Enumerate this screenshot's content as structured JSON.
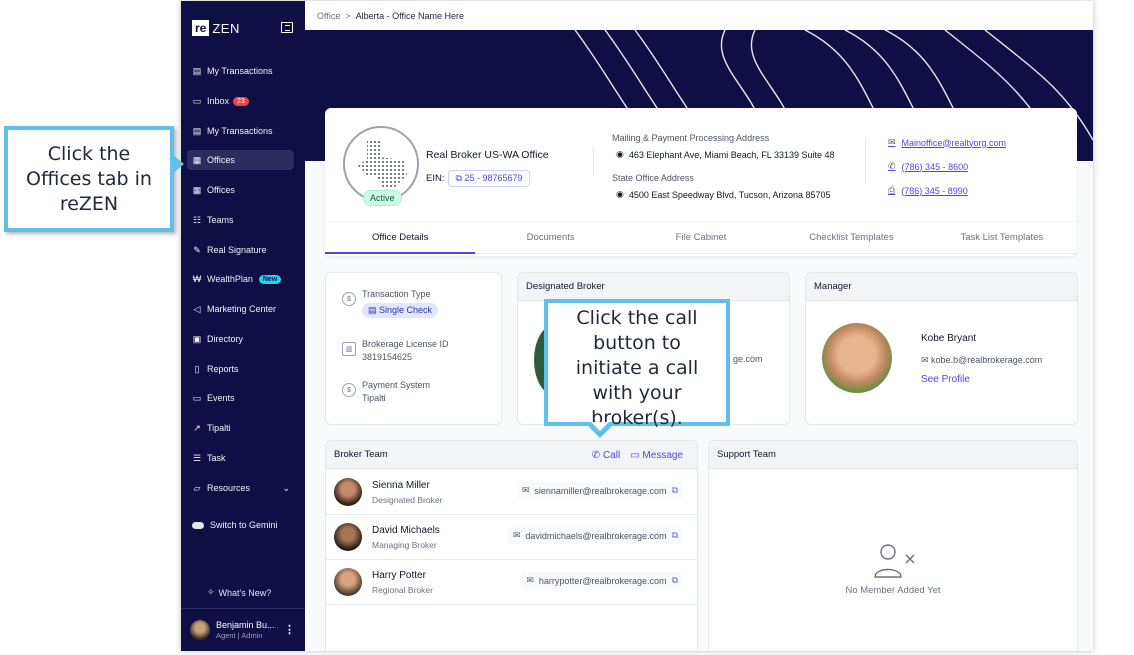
{
  "app": {
    "logo_re": "re",
    "logo_zen": "ZEN"
  },
  "sidebar": {
    "items": [
      {
        "label": "My Transactions",
        "icon": "clipboard-icon"
      },
      {
        "label": "Inbox",
        "icon": "inbox-icon",
        "badge": "23"
      },
      {
        "label": "My Transactions",
        "icon": "clipboard-icon"
      },
      {
        "label": "Offices",
        "icon": "building-icon"
      },
      {
        "label": "Offices",
        "icon": "building-icon"
      },
      {
        "label": "Teams",
        "icon": "users-icon"
      },
      {
        "label": "Real Signature",
        "icon": "signature-icon"
      },
      {
        "label": "WealthPlan",
        "icon": "wealthplan-icon",
        "badge": "New"
      },
      {
        "label": "Marketing Center",
        "icon": "megaphone-icon"
      },
      {
        "label": "Directory",
        "icon": "directory-icon"
      },
      {
        "label": "Reports",
        "icon": "report-icon"
      },
      {
        "label": "Events",
        "icon": "calendar-icon"
      },
      {
        "label": "Tipalti",
        "icon": "external-link-icon"
      },
      {
        "label": "Task",
        "icon": "task-list-icon"
      },
      {
        "label": "Resources",
        "icon": "folder-icon"
      }
    ],
    "switch_label": "Switch to Gemini",
    "whats_new": "What's New?",
    "user": {
      "name": "Benjamin Bu...",
      "role": "Agent | Admin"
    }
  },
  "breadcrumb": {
    "root": "Office",
    "sep": ">",
    "current": "Alberta - Office Name Here"
  },
  "office": {
    "status": "Active",
    "name": "Real Broker US-WA Office",
    "ein_label": "EIN:",
    "ein_value": "25 - 98765679",
    "mailing_label": "Mailing & Payment Processing Address",
    "mailing_value": "463 Elephant Ave, Miami Beach, FL 33139 Suite 48",
    "state_label": "State Office Address",
    "state_value": "4500 East Speedway Blvd, Tucson, Arizona 85705",
    "email": "Mainoffice@realtyorg.com",
    "phone": "(786) 345 - 8600",
    "fax": "(786) 345 - 8990"
  },
  "tabs": [
    "Office Details",
    "Documents",
    "File Cabinet",
    "Checklist Templates",
    "Task List Templates"
  ],
  "details": {
    "transaction_type_label": "Transaction Type",
    "transaction_type_value": "Single Check",
    "license_label": "Brokerage License ID",
    "license_value": "3819154625",
    "payment_label": "Payment System",
    "payment_value": "Tipalti"
  },
  "designated_broker": {
    "title": "Designated Broker",
    "email_partial": "ge.com"
  },
  "manager": {
    "title": "Manager",
    "name": "Kobe Bryant",
    "email": "kobe.b@realbrokerage.com",
    "link": "See Profile"
  },
  "broker_team": {
    "title": "Broker Team",
    "call": "Call",
    "message": "Message",
    "members": [
      {
        "name": "Sienna Miller",
        "role": "Designated Broker",
        "email": "siennamiller@realbrokerage.com"
      },
      {
        "name": "David Michaels",
        "role": "Managing Broker",
        "email": "davidmichaels@realbrokerage.com"
      },
      {
        "name": "Harry Potter",
        "role": "Regional Broker",
        "email": "harrypotter@realbrokerage.com"
      }
    ]
  },
  "support_team": {
    "title": "Support Team",
    "empty": "No Member Added Yet"
  },
  "callouts": {
    "left": "Click the Offices tab in reZEN",
    "call": "Click the call button to initiate a call with your broker(s)."
  },
  "colors": {
    "sidebar": "#0f0f45",
    "accent": "#4f46e5",
    "callout_border": "#5fc1ea"
  }
}
